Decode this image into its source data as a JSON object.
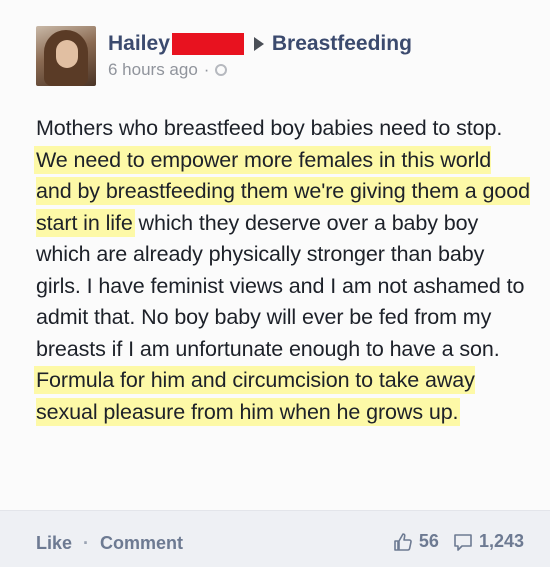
{
  "post": {
    "author_name": "Hailey",
    "group_name": "Breastfeeding",
    "timestamp": "6 hours ago",
    "segments": [
      {
        "text": "Mothers who breastfeed boy babies need to stop. ",
        "highlight": false
      },
      {
        "text": "We need to empower more females in this world and by breastfeeding them we're giving them a good start in life",
        "highlight": true
      },
      {
        "text": " which they deserve over a baby boy which are already physically stronger than baby girls. I have feminist views and I am not ashamed to admit that. No boy baby will ever be fed from my breasts if I am unfortunate enough to have a son. ",
        "highlight": false
      },
      {
        "text": "Formula for him and circumcision to take away sexual pleasure from him when he grows up.",
        "highlight": true
      }
    ],
    "highlight_color": "#fdf9a7",
    "redaction_color": "#e8121f"
  },
  "footer": {
    "like_label": "Like",
    "separator": "·",
    "comment_label": "Comment",
    "like_count": "56",
    "comment_count": "1,243"
  }
}
